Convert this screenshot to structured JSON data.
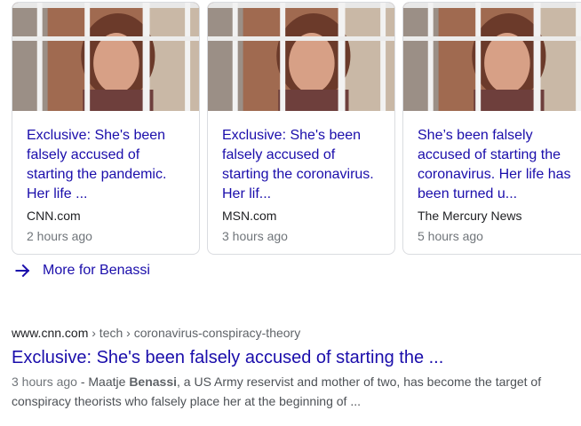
{
  "news_cards": [
    {
      "title": "Exclusive: She's been falsely accused of starting the pandemic. Her life ...",
      "source": "CNN.com",
      "time": "2 hours ago"
    },
    {
      "title": "Exclusive: She's been falsely accused of starting the coronavirus. Her lif...",
      "source": "MSN.com",
      "time": "3 hours ago"
    },
    {
      "title": "She’s been falsely accused of starting the coronavirus. Her life has been turned u...",
      "source": "The Mercury News",
      "time": "5 hours ago"
    }
  ],
  "more_link": {
    "label": "More for Benassi",
    "icon": "arrow-right-icon"
  },
  "result": {
    "site": "www.cnn.com",
    "breadcrumb": " › tech › coronavirus-conspiracy-theory",
    "title": "Exclusive: She's been falsely accused of starting the ...",
    "date": "3 hours ago",
    "snippet_pre": " - Maatje ",
    "snippet_bold": "Benassi",
    "snippet_post": ", a US Army reservist and mother of two, has become the target of conspiracy theorists who falsely place her at the beginning of ..."
  },
  "colors": {
    "link": "#1a0dab",
    "meta": "#70757a",
    "border": "#dadce0"
  }
}
